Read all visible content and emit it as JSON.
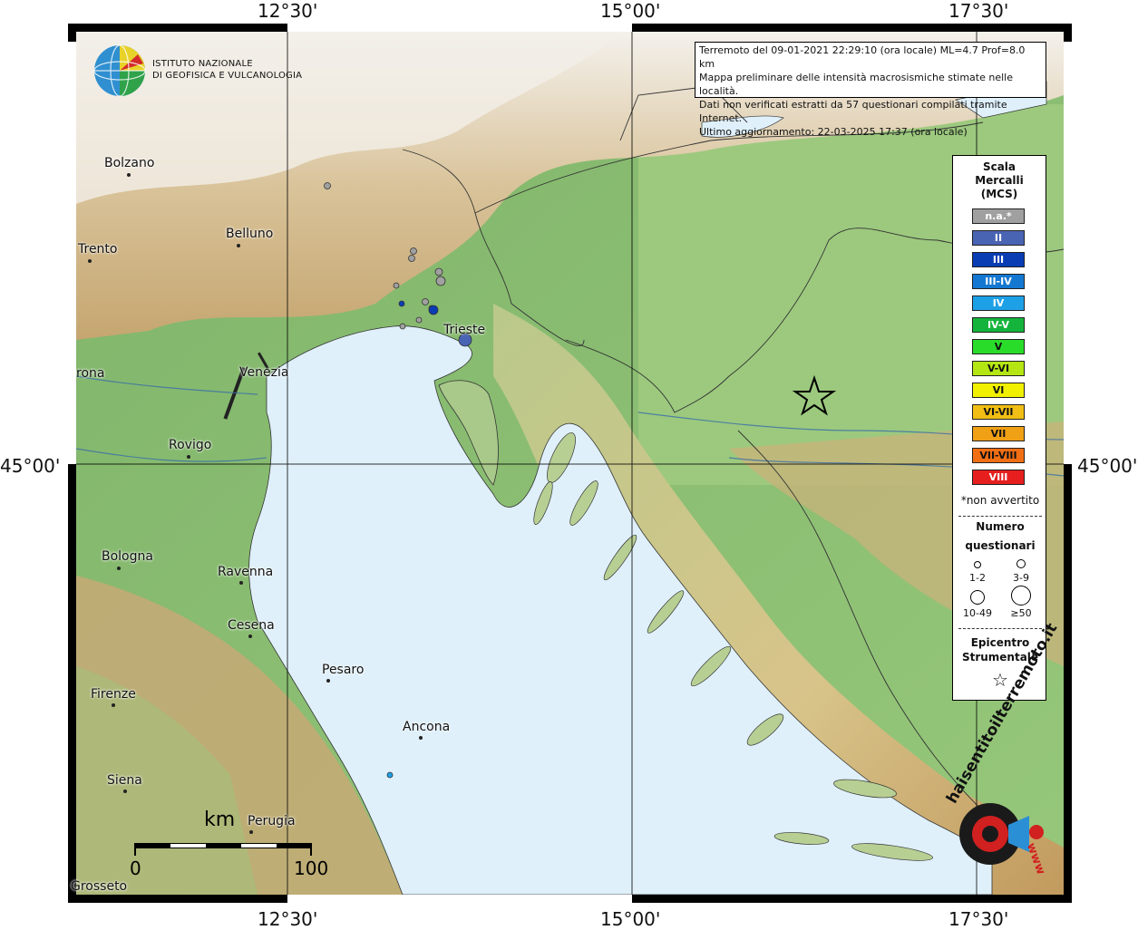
{
  "axes": {
    "top_ticks": [
      "12°30'",
      "15°00'",
      "17°30'"
    ],
    "bottom_ticks": [
      "12°30'",
      "15°00'",
      "17°30'"
    ],
    "left_ticks": [
      "45°00'"
    ],
    "right_ticks": [
      "45°00'"
    ]
  },
  "institute": {
    "line1": "Istituto Nazionale",
    "line2": "di Geofisica e Vulcanologia"
  },
  "info": {
    "line1": "Terremoto del 09-01-2021 22:29:10 (ora locale) ML=4.7 Prof=8.0 km",
    "line2": "Mappa preliminare delle intensità macrosismiche stimate nelle località.",
    "line3": "Dati non verificati estratti da 57 questionari compilati tramite Internet.",
    "line4": "Ultimo aggiornamento: 22-03-2025 17:37 (ora locale)"
  },
  "cities": [
    {
      "name": "Bolzano"
    },
    {
      "name": "Belluno"
    },
    {
      "name": "Trento"
    },
    {
      "name": "Trieste"
    },
    {
      "name": "rona"
    },
    {
      "name": "Venezia"
    },
    {
      "name": "Rovigo"
    },
    {
      "name": "Bologna"
    },
    {
      "name": "Ravenna"
    },
    {
      "name": "Cesena"
    },
    {
      "name": "Pesaro"
    },
    {
      "name": "Firenze"
    },
    {
      "name": "Ancona"
    },
    {
      "name": "Siena"
    },
    {
      "name": "Perugia"
    },
    {
      "name": "Grosseto"
    }
  ],
  "legend": {
    "title1": "Scala",
    "title2": "Mercalli",
    "title3": "(MCS)",
    "classes": [
      {
        "label": "n.a.*",
        "color": "#a0a0a0"
      },
      {
        "label": "II",
        "color": "#4a64b4"
      },
      {
        "label": "III",
        "color": "#0a3cb4"
      },
      {
        "label": "III-IV",
        "color": "#1478d2"
      },
      {
        "label": "IV",
        "color": "#1ea0e6"
      },
      {
        "label": "IV-V",
        "color": "#14b43c"
      },
      {
        "label": "V",
        "color": "#2adc2a"
      },
      {
        "label": "V-VI",
        "color": "#b4e614"
      },
      {
        "label": "VI",
        "color": "#f0f000"
      },
      {
        "label": "VI-VII",
        "color": "#f0be14"
      },
      {
        "label": "VII",
        "color": "#f0a014"
      },
      {
        "label": "VII-VIII",
        "color": "#f06e14"
      },
      {
        "label": "VIII",
        "color": "#e61e1e"
      }
    ],
    "not_felt_note": "*non avvertito",
    "count_title1": "Numero",
    "count_title2": "questionari",
    "size_labels": [
      "1-2",
      "3-9",
      "10-49",
      "≥50"
    ],
    "epicenter_title1": "Epicentro",
    "epicenter_title2": "Strumentale",
    "epicenter_symbol": "☆"
  },
  "scale_bar": {
    "unit": "km",
    "min_label": "0",
    "max_label": "100"
  },
  "hst_logo_text": "haisentitoilterremoto.it",
  "hst_logo_url": "www"
}
